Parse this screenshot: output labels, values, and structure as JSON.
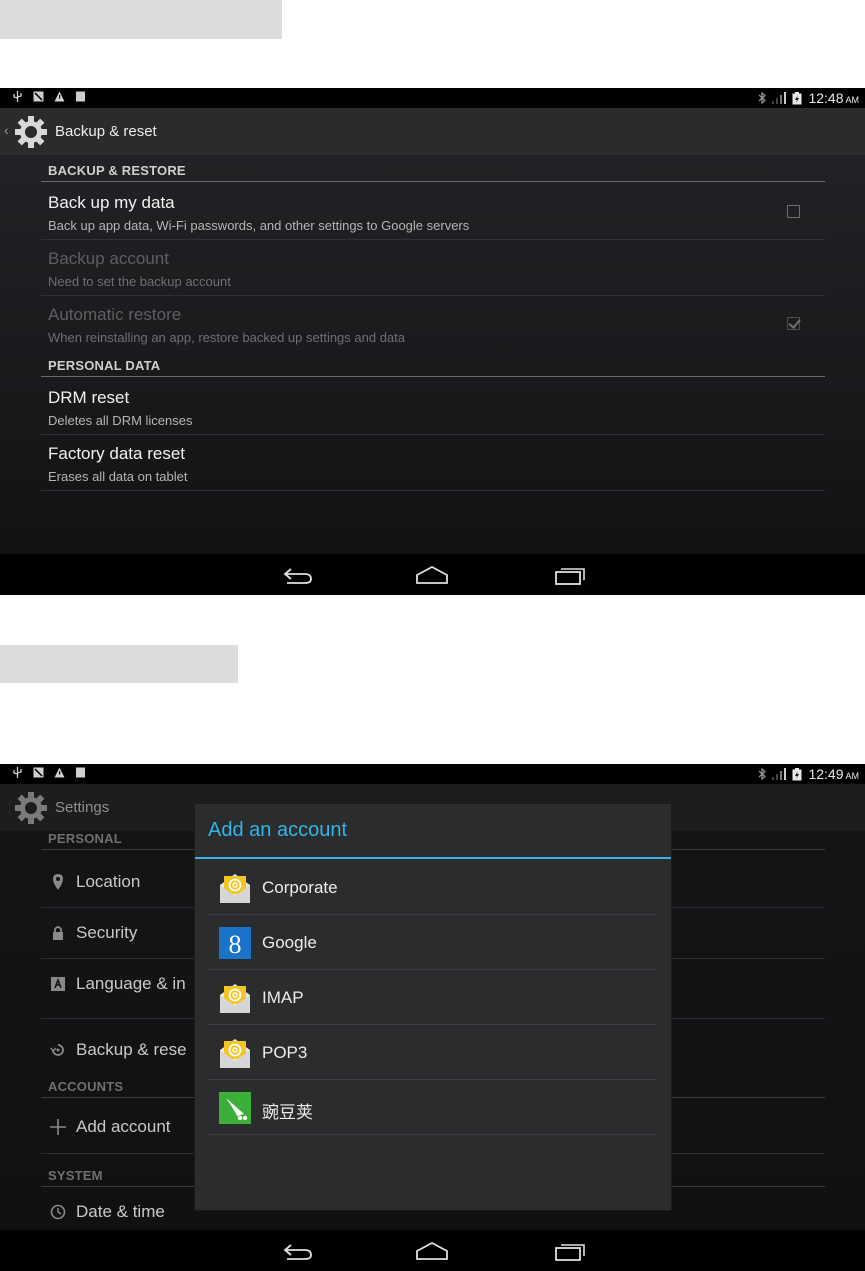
{
  "screen1": {
    "status": {
      "time": "12:48",
      "ampm": "AM"
    },
    "action_bar": {
      "title": "Backup & reset"
    },
    "sections": [
      {
        "header": "BACKUP & RESTORE"
      },
      {
        "header": "PERSONAL DATA"
      }
    ],
    "prefs": [
      {
        "title": "Back up my data",
        "summary": "Back up app data, Wi-Fi passwords, and other settings to Google servers",
        "enabled": true,
        "checked": false
      },
      {
        "title": "Backup account",
        "summary": "Need to set the backup account",
        "enabled": false
      },
      {
        "title": "Automatic restore",
        "summary": "When reinstalling an app, restore backed up settings and data",
        "enabled": false,
        "checked": true
      },
      {
        "title": "DRM reset",
        "summary": "Deletes all DRM licenses",
        "enabled": true
      },
      {
        "title": "Factory data reset",
        "summary": "Erases all data on tablet",
        "enabled": true
      }
    ]
  },
  "screen2": {
    "status": {
      "time": "12:49",
      "ampm": "AM"
    },
    "action_bar": {
      "title": "Settings"
    },
    "list": {
      "personal_header": "PERSONAL",
      "location": "Location",
      "security": "Security",
      "language": "Language & in",
      "backup": "Backup & rese",
      "accounts_header": "ACCOUNTS",
      "add_account": "Add account",
      "system_header": "SYSTEM",
      "date_time": "Date & time"
    },
    "dialog": {
      "title": "Add an account",
      "items": [
        {
          "label": "Corporate",
          "icon": "email-icon"
        },
        {
          "label": "Google",
          "icon": "google-icon"
        },
        {
          "label": "IMAP",
          "icon": "email-icon"
        },
        {
          "label": "POP3",
          "icon": "email-icon"
        },
        {
          "label": "豌豆荚",
          "icon": "wandoujia-icon"
        }
      ]
    }
  },
  "colors": {
    "accent": "#33b5e5",
    "background": "#1b1c1e",
    "text_primary": "#f2f2f2",
    "text_disabled": "#5e5f61"
  }
}
